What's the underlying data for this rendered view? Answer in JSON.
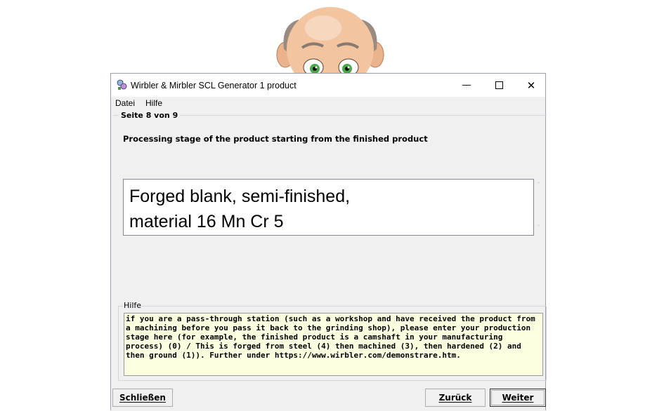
{
  "window": {
    "title": "Wirbler & Mirbler SCL Generator 1 product",
    "minimize_glyph": "—",
    "close_glyph": "✕"
  },
  "menu": {
    "items": [
      "Datei",
      "Hilfe"
    ]
  },
  "page": {
    "legend": "Seite 8 von 9",
    "question": "Processing stage of the product starting from the finished product",
    "answer": "Forged blank, semi-finished,\nmaterial 16 Mn Cr 5"
  },
  "help": {
    "legend": "Hilfe",
    "text": "if you are a pass-through station (such as a workshop and have received the product from a machining before you pass it back to the grinding shop), please enter your production stage here (for example, the finished product is a camshaft in your manufacturing process) (0) / This is forged from steel (4) then machined (3), then hardened (2) and then ground (1)). Further under https://www.wirbler.com/demonstrare.htm."
  },
  "buttons": {
    "close": "Schließen",
    "back": "Zurück",
    "next": "Weiter"
  },
  "icons": {
    "app": "app-icon",
    "scroll_up": "˄",
    "scroll_down": "˅"
  },
  "colors": {
    "window_bg": "#f0f0f0",
    "help_bg": "#ffffe1"
  }
}
